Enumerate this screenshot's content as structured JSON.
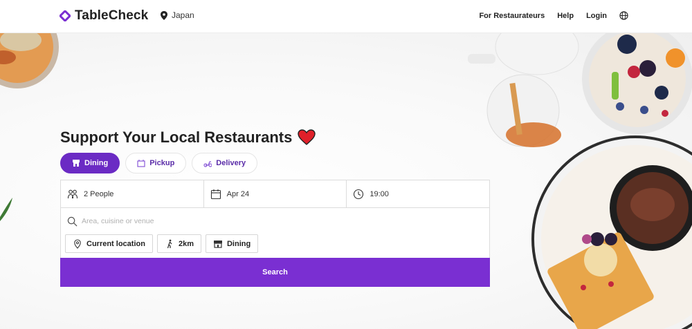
{
  "header": {
    "logo_text": "TableCheck",
    "region": "Japan",
    "nav": {
      "restaurateurs": "For Restaurateurs",
      "help": "Help",
      "login": "Login"
    }
  },
  "hero": {
    "headline": "Support Your Local Restaurants",
    "tabs": [
      {
        "label": "Dining",
        "active": true
      },
      {
        "label": "Pickup",
        "active": false
      },
      {
        "label": "Delivery",
        "active": false
      }
    ]
  },
  "search_panel": {
    "people": "2 People",
    "date": "Apr 24",
    "time": "19:00",
    "search_placeholder": "Area, cuisine or venue",
    "chips": {
      "location": "Current location",
      "distance": "2km",
      "type": "Dining"
    },
    "search_button": "Search"
  },
  "colors": {
    "brand": "#7a2fd2",
    "tab_active": "#6b2bc4",
    "heart": "#e0202a"
  }
}
